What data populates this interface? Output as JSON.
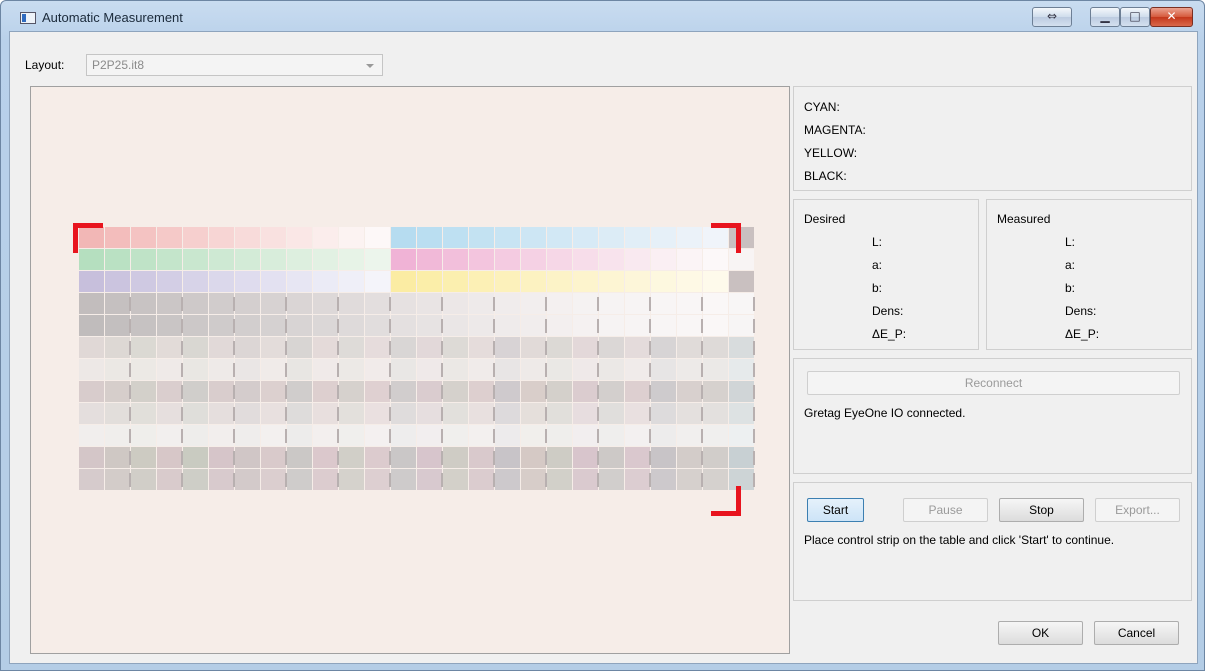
{
  "window": {
    "title": "Automatic Measurement",
    "buttons": {
      "swap": "⇔",
      "minimize": "▁",
      "maximize": "□",
      "close": "✕"
    }
  },
  "layout": {
    "label": "Layout:",
    "value": "P2P25.it8"
  },
  "inks": {
    "cyan": "CYAN:",
    "magenta": "MAGENTA:",
    "yellow": "YELLOW:",
    "black": "BLACK:"
  },
  "desired": {
    "title": "Desired",
    "L": "L:",
    "a": "a:",
    "b": "b:",
    "dens": "Dens:",
    "de": "ΔE_P:"
  },
  "measured": {
    "title": "Measured",
    "L": "L:",
    "a": "a:",
    "b": "b:",
    "dens": "Dens:",
    "de": "ΔE_P:"
  },
  "device": {
    "reconnect_label": "Reconnect",
    "status": "Gretag EyeOne IO connected."
  },
  "controls": {
    "start_label": "Start",
    "pause_label": "Pause",
    "stop_label": "Stop",
    "export_label": "Export...",
    "status": "Place control strip on the table and click 'Start' to continue."
  },
  "dialog": {
    "ok_label": "OK",
    "cancel_label": "Cancel"
  },
  "colors": {
    "marker": "#e8141e",
    "canvas_bg": "#f6ede8"
  },
  "patch_rows": [
    [
      "#f2b7b6",
      "#f3bdbc",
      "#f4c3c2",
      "#f5c9c8",
      "#f6cfce",
      "#f7d5d4",
      "#f8dbda",
      "#f9e1e0",
      "#fae7e6",
      "#fbedec",
      "#fcf3f2",
      "#fdf8f8",
      "#b6dcf0",
      "#badef1",
      "#bee0f2",
      "#c3e2f2",
      "#c8e4f3",
      "#cde6f4",
      "#d2e8f5",
      "#d7eaf6",
      "#dcecf6",
      "#e1eef7",
      "#e6f0f8",
      "#ebf2f9",
      "#f0f4fa",
      "#c9c0c0"
    ],
    [
      "#b5dfbf",
      "#bae1c3",
      "#bfe3c7",
      "#c4e5cb",
      "#c9e7cf",
      "#cee9d3",
      "#d3ebd7",
      "#d8eddb",
      "#ddefdf",
      "#e2f1e3",
      "#e7f3e7",
      "#ecf5ec",
      "#f0b3d6",
      "#f1b9d8",
      "#f2bfdb",
      "#f3c5de",
      "#f4cbe1",
      "#f5d1e4",
      "#f6d7e7",
      "#f7ddea",
      "#f8e3ed",
      "#f9e9f0",
      "#faeff3",
      "#fbf4f6",
      "#fcf8f9",
      "#f8f4f4"
    ],
    [
      "#c7bfdc",
      "#cbc4df",
      "#cfc9e2",
      "#d3cee5",
      "#d7d3e8",
      "#dbd8eb",
      "#dfdcee",
      "#e3e1f1",
      "#e7e6f3",
      "#ebebf6",
      "#efeff8",
      "#f4f4fa",
      "#fbeca3",
      "#fbeea9",
      "#fbefaf",
      "#fcf0b5",
      "#fcf1bb",
      "#fcf2c1",
      "#fcf3c7",
      "#fdf4cd",
      "#fdf5d3",
      "#fdf6d9",
      "#fdf8df",
      "#fef9e5",
      "#fefaeb",
      "#c9c0c0"
    ],
    [
      "#c2bdbd",
      "#c5c0c0",
      "#c8c3c3",
      "#cbc6c6",
      "#cec9c9",
      "#d1cccc",
      "#d4cfcf",
      "#d7d2d2",
      "#dad5d5",
      "#ddd8d8",
      "#e0dbdb",
      "#e3dede",
      "#e6e1e1",
      "#e9e4e4",
      "#ece7e7",
      "#eeeaea",
      "#f0ecec",
      "#f2eeee",
      "#f4f0f0",
      "#f5f2f2",
      "#f6f3f3",
      "#f7f4f4",
      "#f8f5f5",
      "#f9f6f6",
      "#faf7f7",
      "#f8f6f6"
    ],
    [
      "#c0bcbc",
      "#c3bfbf",
      "#c6c2c2",
      "#c9c5c5",
      "#ccc8c8",
      "#cfcbcb",
      "#d2cece",
      "#d5d1d1",
      "#d8d4d4",
      "#dbd7d7",
      "#dedada",
      "#e1dddd",
      "#e4e0e0",
      "#e7e3e3",
      "#eae6e6",
      "#ede9e9",
      "#efebeb",
      "#f1eded",
      "#f3efef",
      "#f5f1f1",
      "#f6f3f3",
      "#f7f4f4",
      "#f8f5f5",
      "#f9f6f6",
      "#faf7f7",
      "#f7f5f5"
    ],
    [
      "#e0d8d6",
      "#ddd8d4",
      "#dbd9d3",
      "#e2dbd8",
      "#d9d7d2",
      "#e1d9d8",
      "#dcd6d5",
      "#e3dcda",
      "#d8d5d3",
      "#e4dad9",
      "#dedbd8",
      "#e6dcdc",
      "#d9d6d5",
      "#e2d8d9",
      "#dddad6",
      "#e5dcdb",
      "#d8d3d5",
      "#e1dad8",
      "#dcd9d5",
      "#e3d8d9",
      "#dbd7d6",
      "#e4dbdb",
      "#d7d4d5",
      "#e0dbd9",
      "#dedad8",
      "#d8dcdd"
    ],
    [
      "#ede8e6",
      "#ebe8e4",
      "#ece9e5",
      "#efeae8",
      "#e9e7e3",
      "#eeeae8",
      "#eae6e5",
      "#f0ebe9",
      "#e8e6e3",
      "#f0eae9",
      "#ece9e6",
      "#f1ebea",
      "#e9e7e5",
      "#efe9e9",
      "#ebe8e5",
      "#f0ebea",
      "#e8e5e5",
      "#eeeae8",
      "#eae8e5",
      "#efe9e9",
      "#ebe8e6",
      "#f0ebea",
      "#e7e5e5",
      "#edeae8",
      "#ebe9e7",
      "#e6eaeb"
    ],
    [
      "#d8cccc",
      "#d6cecb",
      "#d3d0ca",
      "#dacece",
      "#d0cecb",
      "#d9cdcd",
      "#d4cccc",
      "#dcd0cf",
      "#d0cdcc",
      "#ddcfcf",
      "#d6d1cd",
      "#dfd0d1",
      "#d1cdcd",
      "#dacccf",
      "#d5d1cc",
      "#ddcfcf",
      "#cfcacd",
      "#d9ceca",
      "#d4d0cb",
      "#dbcccf",
      "#d3cfcd",
      "#ddcfd0",
      "#cecbcd",
      "#d8d0ce",
      "#d6d1ce",
      "#d0d5d7"
    ],
    [
      "#e4dedd",
      "#e2dedb",
      "#e1dfda",
      "#e6dfde",
      "#dfdeda",
      "#e5dedd",
      "#e1dcdc",
      "#e8e0df",
      "#dedcdb",
      "#e8dfde",
      "#e3e0dc",
      "#eae0e0",
      "#dfdcdc",
      "#e6dedf",
      "#e2e0dc",
      "#e8e0df",
      "#dddadc",
      "#e5dfdb",
      "#e1dfdb",
      "#e7dddf",
      "#e0dedc",
      "#e9e0e0",
      "#dddbdc",
      "#e4e0de",
      "#e3e0de",
      "#dde2e3"
    ],
    [
      "#f1eeed",
      "#f0eeec",
      "#efeeeb",
      "#f2efee",
      "#eeedeb",
      "#f2eeed",
      "#efedec",
      "#f3f0ef",
      "#edeceb",
      "#f3efee",
      "#f0efed",
      "#f4f0f0",
      "#eeeded",
      "#f2eeef",
      "#f0efed",
      "#f3f0ef",
      "#edebec",
      "#f1efec",
      "#efeeec",
      "#f2eeef",
      "#efeeed",
      "#f3f0f0",
      "#edecec",
      "#f1efee",
      "#f0efee",
      "#edf0f1"
    ],
    [
      "#d4c6c8",
      "#cfc8c4",
      "#cdcbc2",
      "#d7c7c8",
      "#c9cbc1",
      "#d6c5c9",
      "#d0c6c6",
      "#d9cacb",
      "#cbc8c6",
      "#dbc8cc",
      "#d1cfc8",
      "#dccbce",
      "#cac7c7",
      "#d7c5cc",
      "#cfccc5",
      "#d9c9cc",
      "#c8c4c8",
      "#d5c9c5",
      "#ceccc5",
      "#d8c5cc",
      "#cdc9c7",
      "#dac8ce",
      "#c8c4c7",
      "#d3ccc9",
      "#d1cdca",
      "#c8d0d3"
    ],
    [
      "#d6cbcc",
      "#d3ccc9",
      "#d1cec8",
      "#d9cbcc",
      "#cecec7",
      "#d8cacd",
      "#d3caca",
      "#dbcecf",
      "#cfcccb",
      "#dccccf",
      "#d5d2cc",
      "#ddcfd1",
      "#cecbcb",
      "#d8c9cf",
      "#d3d0c9",
      "#dbcccf",
      "#cdc9cc",
      "#d7cdc9",
      "#d2d0c9",
      "#dacacf",
      "#d1cecc",
      "#dccdd1",
      "#cdc9cc",
      "#d6d0cd",
      "#d5d1ce",
      "#cdd4d6"
    ]
  ]
}
